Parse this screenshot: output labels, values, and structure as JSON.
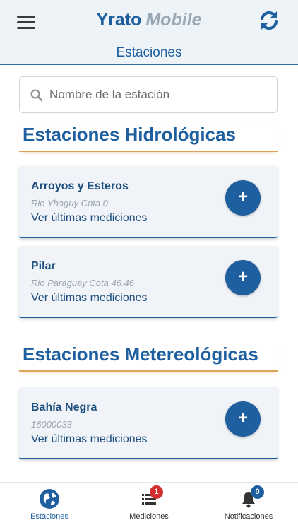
{
  "header": {
    "brand_main": "Yrato",
    "brand_sub": "Mobile",
    "subtitle": "Estaciones",
    "menu_icon": "hamburger-icon",
    "refresh_icon": "refresh-icon"
  },
  "search": {
    "placeholder": "Nombre de la estación",
    "value": ""
  },
  "sections": {
    "hidro": {
      "title": "Estaciones Hidrológicas",
      "cards": [
        {
          "name": "Arroyos y Esteros",
          "desc": "Rio Yhaguy Cota 0",
          "link": "Ver últimas mediciones",
          "add": "+"
        },
        {
          "name": "Pilar",
          "desc": "Rio Paraguay Cota 46.46",
          "link": "Ver últimas mediciones",
          "add": "+"
        }
      ]
    },
    "meteo": {
      "title": "Estaciones Metereológicas",
      "cards": [
        {
          "name": "Bahía Negra",
          "desc": "16000033",
          "link": "Ver últimas mediciones",
          "add": "+"
        }
      ]
    }
  },
  "bottom_nav": {
    "items": [
      {
        "label": "Estaciones",
        "icon": "globe-icon",
        "badge": ""
      },
      {
        "label": "Mediciones",
        "icon": "list-icon",
        "badge": "1"
      },
      {
        "label": "Notificaciones",
        "icon": "bell-icon",
        "badge": "0"
      }
    ]
  },
  "colors": {
    "primary": "#1e5f9f",
    "accent_underline": "#e0a25a",
    "header_bg": "#eef3f8",
    "card_bg": "#f0f4f8",
    "badge_red": "#d32f2f",
    "badge_blue": "#1e5f9f"
  }
}
